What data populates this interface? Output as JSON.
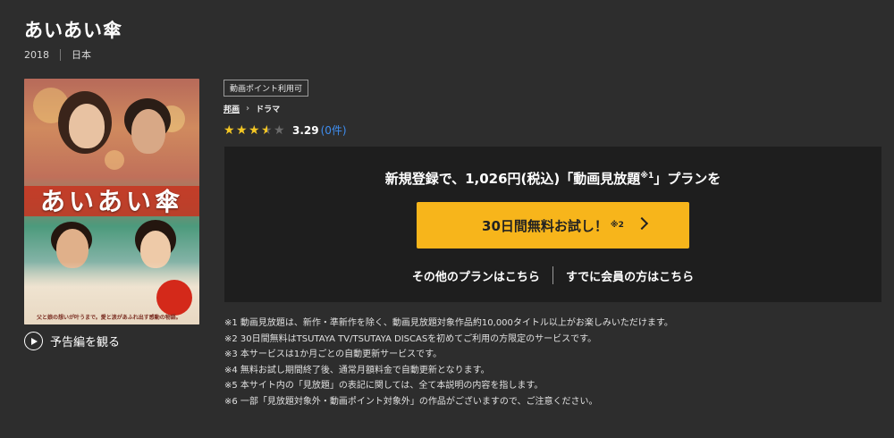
{
  "title": "あいあい傘",
  "meta": {
    "year": "2018",
    "country": "日本"
  },
  "poster": {
    "title_text": "あいあい傘",
    "tagline": "父と娘の想いが叶うまで。愛と涙があふれ出す感動の物語。"
  },
  "trailer": {
    "label": "予告編を観る",
    "icon": "play-circle-icon"
  },
  "badge": "動画ポイント利用可",
  "breadcrumb": {
    "category": "邦画",
    "genre": "ドラマ"
  },
  "rating": {
    "stars": 3.29,
    "score": "3.29",
    "count": "(0件)"
  },
  "plan": {
    "headline": "新規登録で、1,026円(税込)「動画見放題",
    "headline_note": "※1",
    "headline_end": "」プランを",
    "cta_label": "30日間無料お試し！",
    "cta_note": "※2",
    "other_plans": "その他のプランはこちら",
    "member_link": "すでに会員の方はこちら"
  },
  "notes": [
    "※1 動画見放題は、新作・準新作を除く、動画見放題対象作品約10,000タイトル以上がお楽しみいただけます。",
    "※2 30日間無料はTSUTAYA TV/TSUTAYA DISCASを初めてご利用の方限定のサービスです。",
    "※3 本サービスは1か月ごとの自動更新サービスです。",
    "※4 無料お試し期間終了後、通常月額料金で自動更新となります。",
    "※5 本サイト内の「見放題」の表記に関しては、全て本説明の内容を指します。",
    "※6 一部「見放題対象外・動画ポイント対象外」の作品がございますので、ご注意ください。"
  ],
  "colors": {
    "background": "#2d2d2d",
    "panel": "#1e1e1e",
    "cta": "#f7b51b",
    "star": "#f3c624",
    "link": "#3f8ef0"
  }
}
